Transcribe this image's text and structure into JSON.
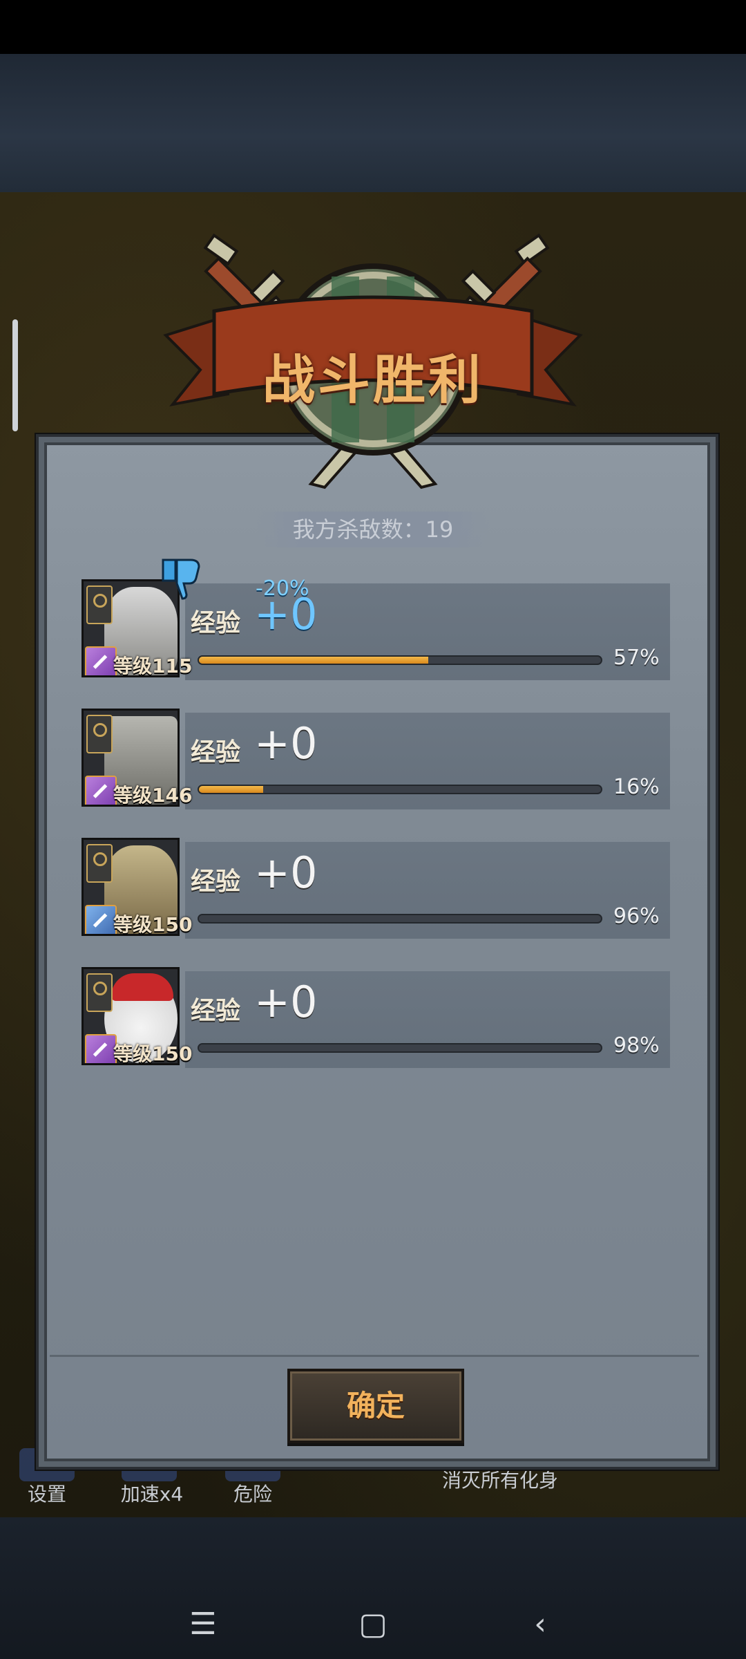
{
  "title": "战斗胜利",
  "kills": {
    "label": "我方杀敌数：19"
  },
  "heroes": [
    {
      "level": "等级115",
      "exp_label": "经验",
      "exp_value": "+0",
      "bonus": "-20%",
      "progress": 0.57,
      "percent": "57%",
      "class_color": "purple"
    },
    {
      "level": "等级146",
      "exp_label": "经验",
      "exp_value": "+0",
      "bonus": "",
      "progress": 0.16,
      "percent": "16%",
      "class_color": "purple"
    },
    {
      "level": "等级150",
      "exp_label": "经验",
      "exp_value": "+0",
      "bonus": "",
      "progress": 0.96,
      "percent": "96%",
      "class_color": "blue"
    },
    {
      "level": "等级150",
      "exp_label": "经验",
      "exp_value": "+0",
      "bonus": "",
      "progress": 0.98,
      "percent": "98%",
      "class_color": "purple"
    }
  ],
  "confirm_label": "确定",
  "game_menu": {
    "settings": "设置",
    "speed": "加速x4",
    "danger": "危险",
    "destroy_all": "消灭所有化身"
  },
  "nav": {
    "menu": "☰",
    "home": "▢",
    "back": "‹"
  },
  "colors": {
    "title": "#f0b66a",
    "bar_fill": "#e8a030",
    "bonus": "#7fd0ff"
  }
}
